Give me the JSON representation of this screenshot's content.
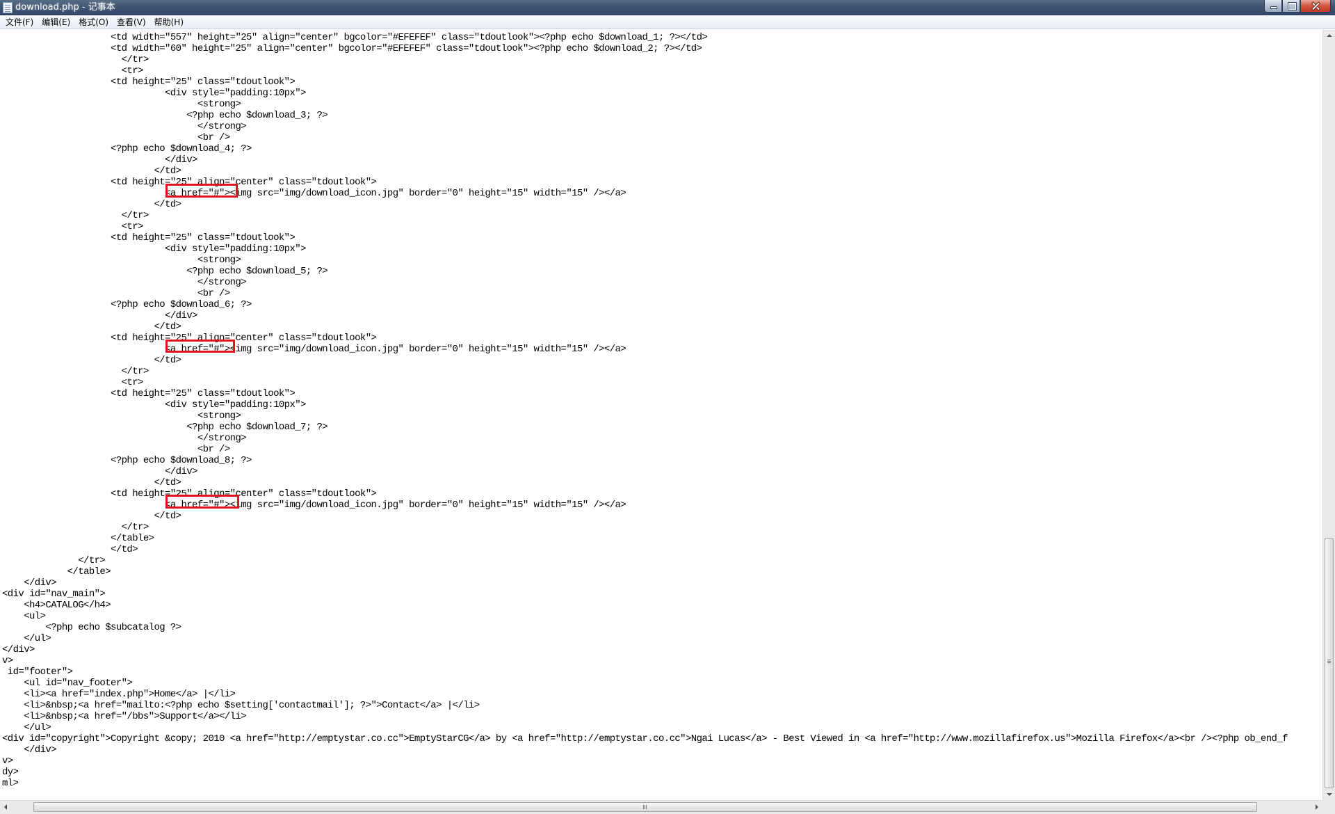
{
  "window": {
    "title": "download.php - 记事本"
  },
  "menu": {
    "items": [
      "文件(F)",
      "编辑(E)",
      "格式(O)",
      "查看(V)",
      "帮助(H)"
    ]
  },
  "editor": {
    "lines": [
      "                    <td width=\"557\" height=\"25\" align=\"center\" bgcolor=\"#EFEFEF\" class=\"tdoutlook\"><?php echo $download_1; ?></td>",
      "                    <td width=\"60\" height=\"25\" align=\"center\" bgcolor=\"#EFEFEF\" class=\"tdoutlook\"><?php echo $download_2; ?></td>",
      "                      </tr>",
      "                      <tr>",
      "                    <td height=\"25\" class=\"tdoutlook\">",
      "                              <div style=\"padding:10px\">",
      "                                    <strong>",
      "                                  <?php echo $download_3; ?>",
      "                                    </strong>",
      "                                    <br />",
      "                    <?php echo $download_4; ?>",
      "                              </div>",
      "                            </td>",
      "                    <td height=\"25\" align=\"center\" class=\"tdoutlook\">",
      "                              <a href=\"#\"><img src=\"img/download_icon.jpg\" border=\"0\" height=\"15\" width=\"15\" /></a>",
      "                            </td>",
      "                      </tr>",
      "                      <tr>",
      "                    <td height=\"25\" class=\"tdoutlook\">",
      "                              <div style=\"padding:10px\">",
      "                                    <strong>",
      "                                  <?php echo $download_5; ?>",
      "                                    </strong>",
      "                                    <br />",
      "                    <?php echo $download_6; ?>",
      "                              </div>",
      "                            </td>",
      "                    <td height=\"25\" align=\"center\" class=\"tdoutlook\">",
      "                              <a href=\"#\"><img src=\"img/download_icon.jpg\" border=\"0\" height=\"15\" width=\"15\" /></a>",
      "                            </td>",
      "                      </tr>",
      "                      <tr>",
      "                    <td height=\"25\" class=\"tdoutlook\">",
      "                              <div style=\"padding:10px\">",
      "                                    <strong>",
      "                                  <?php echo $download_7; ?>",
      "                                    </strong>",
      "                                    <br />",
      "                    <?php echo $download_8; ?>",
      "                              </div>",
      "                            </td>",
      "                    <td height=\"25\" align=\"center\" class=\"tdoutlook\">",
      "                              <a href=\"#\"><img src=\"img/download_icon.jpg\" border=\"0\" height=\"15\" width=\"15\" /></a>",
      "                            </td>",
      "                      </tr>",
      "                    </table>",
      "                    </td>",
      "              </tr>",
      "            </table>",
      "    </div>",
      "<div id=\"nav_main\">",
      "    <h4>CATALOG</h4>",
      "    <ul>",
      "        <?php echo $subcatalog ?>",
      "    </ul>",
      "</div>",
      "v>",
      " id=\"footer\">",
      "    <ul id=\"nav_footer\">",
      "    <li><a href=\"index.php\">Home</a> |</li>",
      "    <li>&nbsp;<a href=\"mailto:<?php echo $setting['contactmail']; ?>\">Contact</a> |</li>",
      "    <li>&nbsp;<a href=\"/bbs\">Support</a></li>",
      "    </ul>",
      "<div id=\"copyright\">Copyright &copy; 2010 <a href=\"http://emptystar.co.cc\">EmptyStarCG</a> by <a href=\"http://emptystar.co.cc\">Ngai Lucas</a> - Best Viewed in <a href=\"http://www.mozillafirefox.us\">Mozilla Firefox</a><br /><?php ob_end_f",
      "    </div>",
      "v>",
      "dy>",
      "ml>"
    ],
    "highlight_color": "#e0141e"
  }
}
